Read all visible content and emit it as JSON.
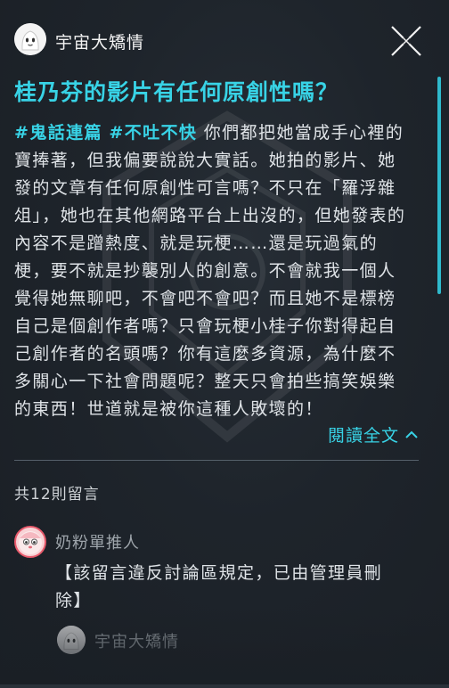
{
  "post": {
    "author": "宇宙大矯情",
    "title": "桂乃芬的影片有任何原創性嗎？",
    "tags": [
      "#鬼話連篇",
      "#不吐不快"
    ],
    "body": "你們都把她當成手心裡的寶捧著，但我偏要說說大實話。她拍的影片、她發的文章有任何原創性可言嗎？不只在「羅浮雜俎」，她也在其他網路平台上出沒的，但她發表的內容不是蹭熱度、就是玩梗……還是玩過氣的梗，要不就是抄襲別人的創意。不會就我一個人覺得她無聊吧，不會吧不會吧？而且她不是標榜自己是個創作者嗎？只會玩梗小桂子你對得起自己創作者的名頭嗎？你有這麼多資源，為什麼不多關心一下社會問題呢？整天只會拍些搞笑娛樂的東西！世道就是被你這種人敗壞的！",
    "read_more_label": "閱讀全文"
  },
  "comments": {
    "count_label": "共12則留言",
    "items": [
      {
        "author": "奶粉單推人",
        "text": "【該留言違反討論區規定，已由管理員刪除】"
      }
    ],
    "reply_preview": {
      "author": "宇宙大矯情"
    }
  },
  "icons": {
    "close": "close-x-icon",
    "chevron": "chevron-up-icon"
  },
  "colors": {
    "accent": "#38d3e6",
    "background": "#1e242b",
    "text": "#dfe3e7",
    "muted": "#9ea5ab"
  }
}
